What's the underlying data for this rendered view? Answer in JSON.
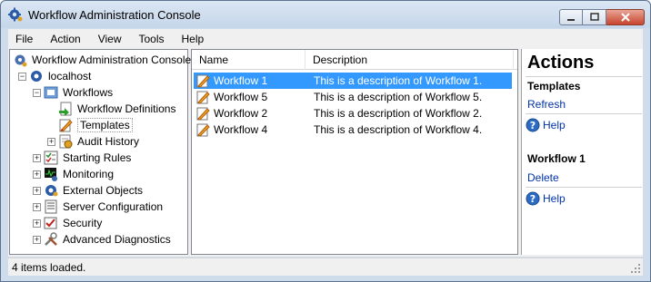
{
  "window": {
    "title": "Workflow Administration Console"
  },
  "menu": [
    "File",
    "Action",
    "View",
    "Tools",
    "Help"
  ],
  "tree": {
    "root": "Workflow Administration Console",
    "server": "localhost",
    "workflows": "Workflows",
    "definitions": "Workflow Definitions",
    "templates": "Templates",
    "audit": "Audit History",
    "starting_rules": "Starting Rules",
    "monitoring": "Monitoring",
    "external_objects": "External Objects",
    "server_configuration": "Server Configuration",
    "security": "Security",
    "advanced_diagnostics": "Advanced Diagnostics"
  },
  "list": {
    "columns": [
      "Name",
      "Description"
    ],
    "rows": [
      {
        "name": "Workflow 1",
        "description": "This is a description of Workflow 1."
      },
      {
        "name": "Workflow 5",
        "description": "This is a description of Workflow 5."
      },
      {
        "name": "Workflow 2",
        "description": "This is a description of Workflow 2."
      },
      {
        "name": "Workflow 4",
        "description": "This is a description of Workflow 4."
      }
    ]
  },
  "actions": {
    "title": "Actions",
    "section1": {
      "header": "Templates",
      "link": "Refresh",
      "help": "Help"
    },
    "section2": {
      "header": "Workflow 1",
      "link": "Delete",
      "help": "Help"
    }
  },
  "status": "4 items loaded.",
  "colors": {
    "selection": "#3399ff",
    "link": "#0033aa"
  }
}
